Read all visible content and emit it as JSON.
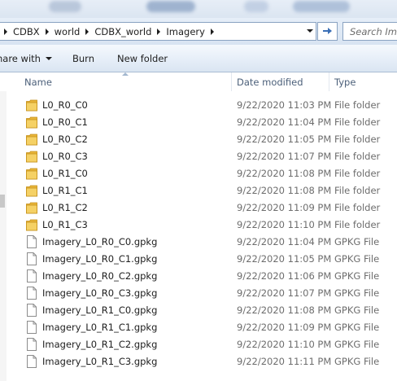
{
  "breadcrumb": [
    "CDBX",
    "world",
    "CDBX_world",
    "Imagery"
  ],
  "search": {
    "placeholder": "Search Imagery"
  },
  "toolbar": {
    "share_label": "hare with",
    "burn_label": "Burn",
    "new_folder_label": "New folder"
  },
  "columns": {
    "name": "Name",
    "date": "Date modified",
    "type": "Type"
  },
  "files": [
    {
      "name": "L0_R0_C0",
      "date": "9/22/2020 11:03 PM",
      "type": "File folder",
      "icon": "folder-icon"
    },
    {
      "name": "L0_R0_C1",
      "date": "9/22/2020 11:04 PM",
      "type": "File folder",
      "icon": "folder-icon"
    },
    {
      "name": "L0_R0_C2",
      "date": "9/22/2020 11:05 PM",
      "type": "File folder",
      "icon": "folder-icon"
    },
    {
      "name": "L0_R0_C3",
      "date": "9/22/2020 11:07 PM",
      "type": "File folder",
      "icon": "folder-icon"
    },
    {
      "name": "L0_R1_C0",
      "date": "9/22/2020 11:08 PM",
      "type": "File folder",
      "icon": "folder-icon"
    },
    {
      "name": "L0_R1_C1",
      "date": "9/22/2020 11:08 PM",
      "type": "File folder",
      "icon": "folder-icon"
    },
    {
      "name": "L0_R1_C2",
      "date": "9/22/2020 11:09 PM",
      "type": "File folder",
      "icon": "folder-icon"
    },
    {
      "name": "L0_R1_C3",
      "date": "9/22/2020 11:10 PM",
      "type": "File folder",
      "icon": "folder-icon"
    },
    {
      "name": "Imagery_L0_R0_C0.gpkg",
      "date": "9/22/2020 11:04 PM",
      "type": "GPKG File",
      "icon": "file-icon"
    },
    {
      "name": "Imagery_L0_R0_C1.gpkg",
      "date": "9/22/2020 11:05 PM",
      "type": "GPKG File",
      "icon": "file-icon"
    },
    {
      "name": "Imagery_L0_R0_C2.gpkg",
      "date": "9/22/2020 11:06 PM",
      "type": "GPKG File",
      "icon": "file-icon"
    },
    {
      "name": "Imagery_L0_R0_C3.gpkg",
      "date": "9/22/2020 11:07 PM",
      "type": "GPKG File",
      "icon": "file-icon"
    },
    {
      "name": "Imagery_L0_R1_C0.gpkg",
      "date": "9/22/2020 11:08 PM",
      "type": "GPKG File",
      "icon": "file-icon"
    },
    {
      "name": "Imagery_L0_R1_C1.gpkg",
      "date": "9/22/2020 11:09 PM",
      "type": "GPKG File",
      "icon": "file-icon"
    },
    {
      "name": "Imagery_L0_R1_C2.gpkg",
      "date": "9/22/2020 11:10 PM",
      "type": "GPKG File",
      "icon": "file-icon"
    },
    {
      "name": "Imagery_L0_R1_C3.gpkg",
      "date": "9/22/2020 11:11 PM",
      "type": "GPKG File",
      "icon": "file-icon"
    }
  ]
}
